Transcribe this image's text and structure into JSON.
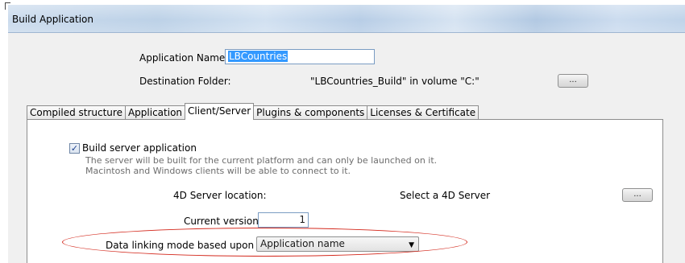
{
  "window": {
    "title": "Build Application"
  },
  "app_name": {
    "label": "Application Name:",
    "value": "LBCountries"
  },
  "destination": {
    "label": "Destination Folder:",
    "value": "\"LBCountries_Build\" in volume \"C:\"",
    "button_label": "..."
  },
  "tabs": [
    {
      "label": "Compiled structure"
    },
    {
      "label": "Application"
    },
    {
      "label": "Client/Server",
      "active": true
    },
    {
      "label": "Plugins & components"
    },
    {
      "label": "Licenses & Certificate"
    }
  ],
  "client_server": {
    "build_server": {
      "checked": true,
      "check_glyph": "✓",
      "label": "Build server application",
      "desc_line1": "The server will be built for the current platform and can only be launched on it.",
      "desc_line2": "Macintosh and Windows clients will be able to connect to it."
    },
    "server_location": {
      "label": "4D Server location:",
      "value": "Select a 4D Server",
      "button_label": "..."
    },
    "current_version": {
      "label": "Current version:",
      "value": "1"
    },
    "data_linking": {
      "label": "Data linking mode based upon the",
      "selected": "Application name",
      "arrow_glyph": "▼"
    }
  },
  "annotation": {
    "color": "#d42a1e"
  }
}
